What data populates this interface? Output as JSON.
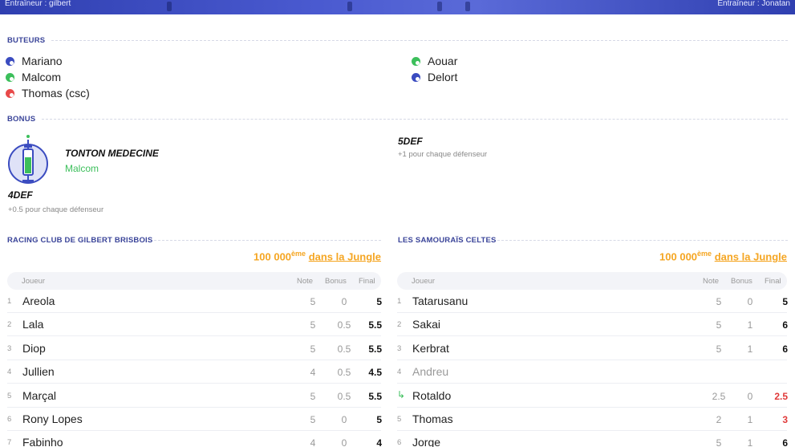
{
  "header": {
    "coach_left": "Entraîneur : gilbert",
    "coach_right": "Entraîneur : Jonatan"
  },
  "scorers": {
    "title": "BUTEURS",
    "left": [
      {
        "name": "Mariano",
        "color": "#3b4cc0"
      },
      {
        "name": "Malcom",
        "color": "#3cbf5b"
      },
      {
        "name": "Thomas (csc)",
        "color": "#e84a4a"
      }
    ],
    "right": [
      {
        "name": "Aouar",
        "color": "#3cbf5b"
      },
      {
        "name": "Delort",
        "color": "#3b4cc0"
      }
    ]
  },
  "bonus": {
    "title": "BONUS",
    "left_name": "TONTON MEDECINE",
    "left_player": "Malcom",
    "left_tag": "4DEF",
    "left_desc": "+0.5 pour chaque défenseur",
    "right_tag": "5DEF",
    "right_desc": "+1 pour chaque défenseur"
  },
  "teams": [
    {
      "name": "RACING CLUB DE GILBERT BRISBOIS",
      "rank_num": "100 000",
      "rank_sup": "ème",
      "rank_link": "dans la Jungle",
      "headers": {
        "player": "Joueur",
        "note": "Note",
        "bonus": "Bonus",
        "final": "Final"
      },
      "rows": [
        {
          "num": "1",
          "name": "Areola",
          "note": "5",
          "bonus": "0",
          "final": "5"
        },
        {
          "num": "2",
          "name": "Lala",
          "note": "5",
          "bonus": "0.5",
          "final": "5.5"
        },
        {
          "num": "3",
          "name": "Diop",
          "note": "5",
          "bonus": "0.5",
          "final": "5.5"
        },
        {
          "num": "4",
          "name": "Jullien",
          "note": "4",
          "bonus": "0.5",
          "final": "4.5"
        },
        {
          "num": "5",
          "name": "Marçal",
          "note": "5",
          "bonus": "0.5",
          "final": "5.5"
        },
        {
          "num": "6",
          "name": "Rony Lopes",
          "note": "5",
          "bonus": "0",
          "final": "5"
        },
        {
          "num": "7",
          "name": "Fabinho",
          "note": "4",
          "bonus": "0",
          "final": "4"
        }
      ]
    },
    {
      "name": "LES SAMOURAÏS CELTES",
      "rank_num": "100 000",
      "rank_sup": "ème",
      "rank_link": "dans la Jungle",
      "headers": {
        "player": "Joueur",
        "note": "Note",
        "bonus": "Bonus",
        "final": "Final"
      },
      "rows": [
        {
          "num": "1",
          "name": "Tatarusanu",
          "note": "5",
          "bonus": "0",
          "final": "5"
        },
        {
          "num": "2",
          "name": "Sakai",
          "note": "5",
          "bonus": "1",
          "final": "6"
        },
        {
          "num": "3",
          "name": "Kerbrat",
          "note": "5",
          "bonus": "1",
          "final": "6"
        },
        {
          "num": "4",
          "name": "Andreu",
          "note": "",
          "bonus": "",
          "final": ""
        },
        {
          "num": "",
          "name": "Rotaldo",
          "note": "2.5",
          "bonus": "0",
          "final": "2.5"
        },
        {
          "num": "5",
          "name": "Thomas",
          "note": "2",
          "bonus": "1",
          "final": "3"
        },
        {
          "num": "6",
          "name": "Jorge",
          "note": "5",
          "bonus": "1",
          "final": "6"
        }
      ]
    }
  ],
  "colors": {
    "accent": "#3a4499",
    "rank": "#f5a623",
    "green": "#3cbf5b",
    "red": "#e03a3a"
  }
}
